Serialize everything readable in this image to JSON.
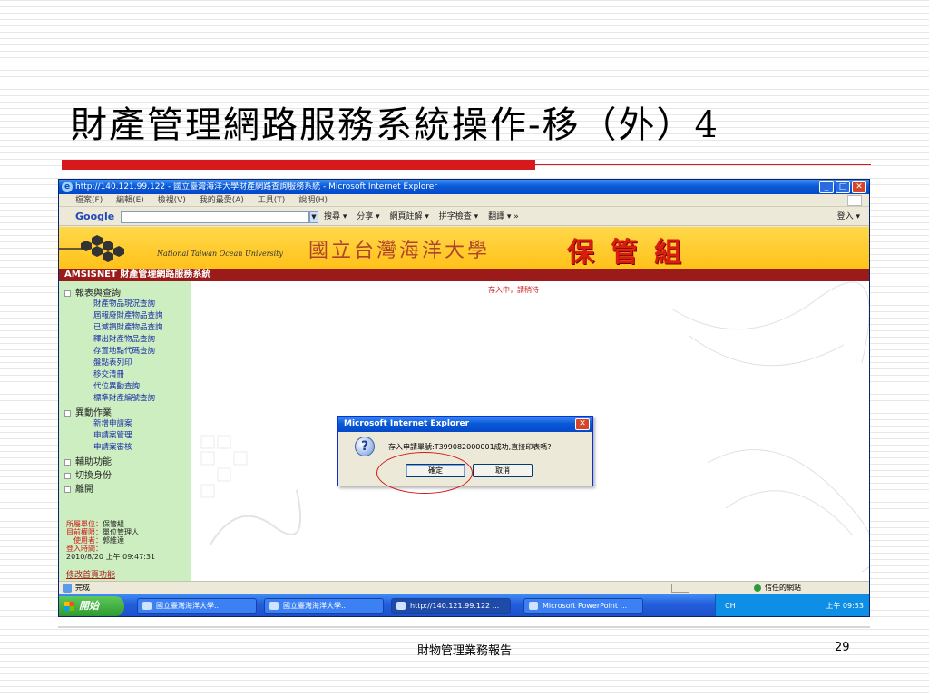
{
  "slide": {
    "title": "財產管理網路服務系統操作-移（外）4",
    "footer": "財物管理業務報告",
    "page_number": "29"
  },
  "browser": {
    "window_title": "http://140.121.99.122 - 國立臺灣海洋大學財產網路查詢服務系統 - Microsoft Internet Explorer",
    "menu": [
      "檔案(F)",
      "編輯(E)",
      "檢視(V)",
      "我的最愛(A)",
      "工具(T)",
      "說明(H)"
    ],
    "google": {
      "logo": "Google",
      "search_value": "",
      "items": [
        "搜尋 ▾",
        "分享 ▾",
        "網頁註解 ▾",
        "拼字檢查 ▾",
        "翻譯 ▾ »"
      ],
      "right": "登入 ▾"
    },
    "status_text": "完成",
    "trusted_zone": "信任的網站"
  },
  "app": {
    "english_name": "National Taiwan Ocean University",
    "university_name": "國立台灣海洋大學",
    "department": "保管組",
    "system_title": "AMSISNET 財產管理網路服務系統",
    "saving_notice": "存入中，請稍待"
  },
  "sidebar": {
    "reports_section": "報表與查詢",
    "report_links": [
      "財產物品現況查詢",
      "屆報廢財產物品查詢",
      "已減損財產物品查詢",
      "釋出財產物品查詢",
      "存置地點代碼查詢",
      "盤點表列印",
      "移交清冊",
      "代位異動查詢",
      "標準財產編號查詢"
    ],
    "change_section": "異動作業",
    "change_links": [
      "新增申請案",
      "申請案管理",
      "申請案審核"
    ],
    "other_sections": [
      "輔助功能",
      "切換身份",
      "離開"
    ],
    "info": [
      {
        "k": "所屬單位：",
        "v": "保管組"
      },
      {
        "k": "目前權限：",
        "v": "單位管理人"
      },
      {
        "k": "　使用者：",
        "v": "郭維達"
      },
      {
        "k": "登入時間：",
        "v": ""
      },
      {
        "k": "",
        "v": "2010/8/20 上午 09:47:31"
      }
    ],
    "modify_link": "修改首頁功能"
  },
  "dialog": {
    "title": "Microsoft Internet Explorer",
    "message": "存入申請單號:T399082000001成功,直接印表嗎?",
    "ok_label": "確定",
    "cancel_label": "取消"
  },
  "taskbar": {
    "start_label": "開始",
    "tasks": [
      "國立臺灣海洋大學...",
      "國立臺灣海洋大學...",
      "http://140.121.99.122 ...",
      "Microsoft PowerPoint ..."
    ],
    "tray_lang": "CH",
    "clock": "上午 09:53"
  },
  "colors": {
    "title_accent": "#d7191d",
    "banner": "#ffc21a",
    "system_bar": "#9b1a1a",
    "sidebar_bg": "#cdeec0",
    "highlight_ellipse": "#d01818"
  }
}
